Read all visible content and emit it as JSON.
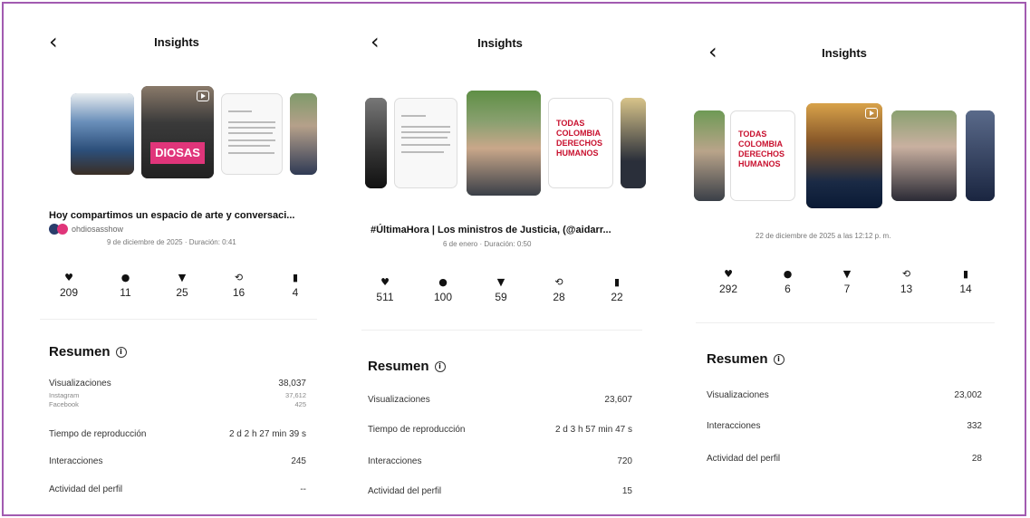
{
  "panels": [
    {
      "title": "Insights",
      "caption": "Hoy compartimos un espacio de arte y conversaci...",
      "account": "ohdiosasshow",
      "meta": "9 de diciembre de 2025 · Duración: 0:41",
      "stats": {
        "likes": "209",
        "comments": "11",
        "shares": "25",
        "reposts": "16",
        "saves": "4"
      },
      "resumen_title": "Resumen",
      "rows": [
        {
          "label": "Visualizaciones",
          "value": "38,037"
        },
        {
          "label": "Tiempo de reproducción",
          "value": "2 d 2 h 27 min 39 s"
        },
        {
          "label": "Interacciones",
          "value": "245"
        },
        {
          "label": "Actividad del perfil",
          "value": "--"
        }
      ],
      "breakdown": [
        {
          "label": "Instagram",
          "value": "37,612"
        },
        {
          "label": "Facebook",
          "value": "425"
        }
      ],
      "thumb_text": "DIOSAS"
    },
    {
      "title": "Insights",
      "caption": "#ÚltimaHora | Los ministros de Justicia, (@aidarr...",
      "meta": "6 de enero · Duración: 0:50",
      "stats": {
        "likes": "511",
        "comments": "100",
        "shares": "59",
        "reposts": "28",
        "saves": "22"
      },
      "resumen_title": "Resumen",
      "rows": [
        {
          "label": "Visualizaciones",
          "value": "23,607"
        },
        {
          "label": "Tiempo de reproducción",
          "value": "2 d 3 h 57 min 47 s"
        },
        {
          "label": "Interacciones",
          "value": "720"
        },
        {
          "label": "Actividad del perfil",
          "value": "15"
        }
      ],
      "thumb_text": "TODAS COLOMBIA DERECHOS HUMANOS"
    },
    {
      "title": "Insights",
      "meta": "22 de diciembre de 2025 a las 12:12 p. m.",
      "stats": {
        "likes": "292",
        "comments": "6",
        "shares": "7",
        "reposts": "13",
        "saves": "14"
      },
      "resumen_title": "Resumen",
      "rows": [
        {
          "label": "Visualizaciones",
          "value": "23,002"
        },
        {
          "label": "Interacciones",
          "value": "332"
        },
        {
          "label": "Actividad del perfil",
          "value": "28"
        }
      ],
      "thumb_text": "TODAS COLOMBIA DERECHOS HUMANOS"
    }
  ],
  "icons": {
    "back": "‹",
    "like": "♥",
    "comment": "●",
    "share": "▼",
    "repost": "⟲",
    "save": "▮",
    "info": "i"
  },
  "colors": {
    "frame": "#a25bb0",
    "accent_pink": "#e0357a",
    "accent_red": "#c8102e"
  }
}
